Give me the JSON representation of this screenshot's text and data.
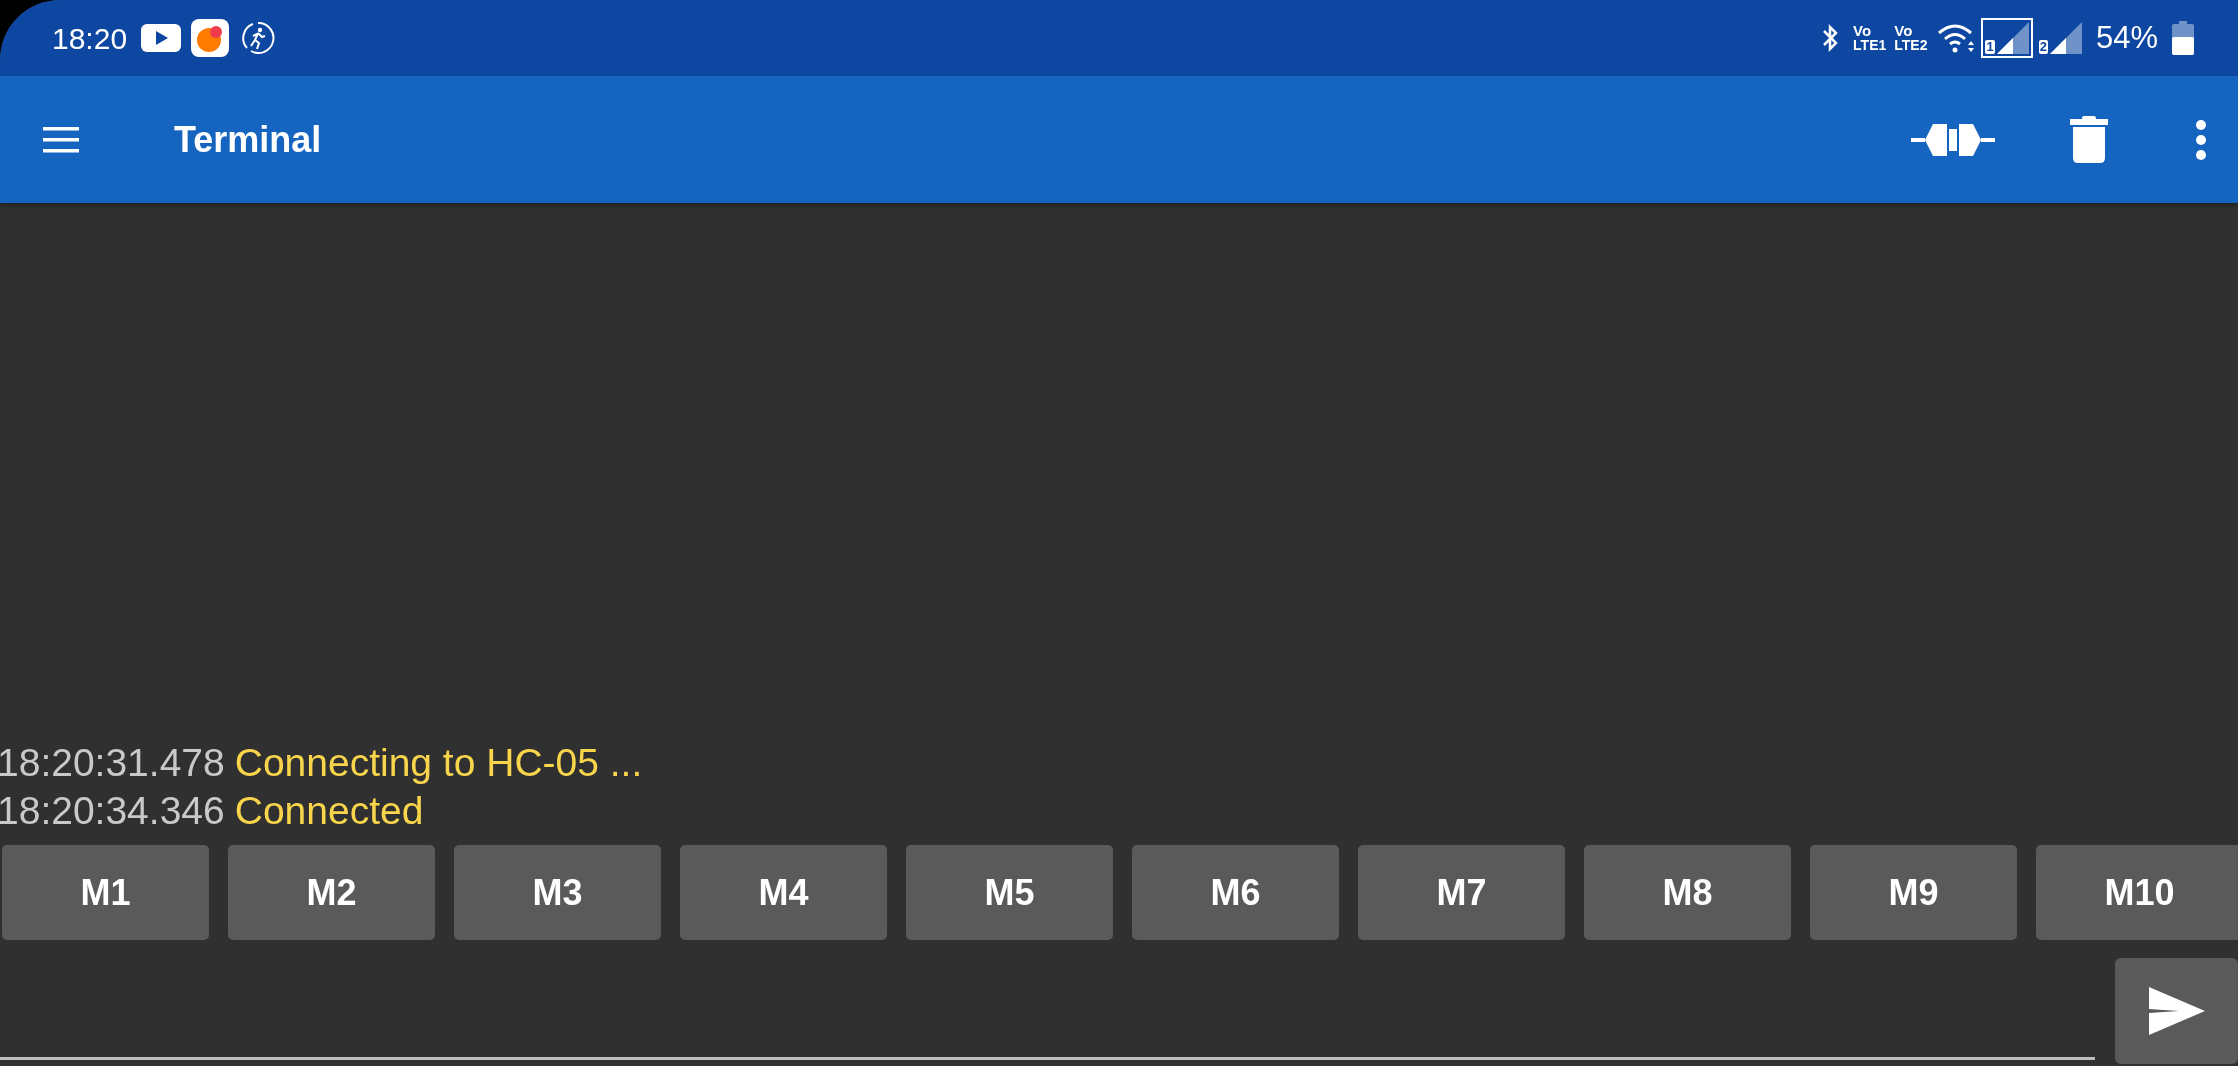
{
  "status_bar": {
    "time": "18:20",
    "volte": [
      {
        "top": "Vo",
        "bottom": "LTE1"
      },
      {
        "top": "Vo",
        "bottom": "LTE2"
      }
    ],
    "sims": [
      {
        "label": "1",
        "selected": true
      },
      {
        "label": "2",
        "selected": false
      }
    ],
    "battery_text": "54%"
  },
  "app_bar": {
    "title": "Terminal"
  },
  "log": [
    {
      "time": "18:20:31.478",
      "message": "Connecting to HC-05 ..."
    },
    {
      "time": "18:20:34.346",
      "message": "Connected"
    }
  ],
  "macro_buttons": [
    "M1",
    "M2",
    "M3",
    "M4",
    "M5",
    "M6",
    "M7",
    "M8",
    "M9",
    "M10"
  ]
}
